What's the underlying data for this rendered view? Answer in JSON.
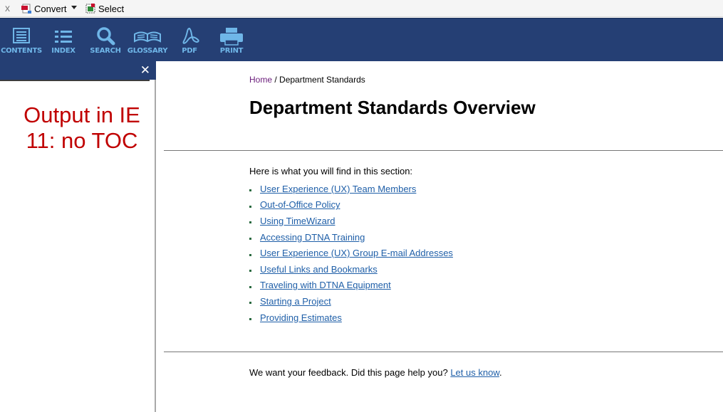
{
  "ie_toolbar": {
    "close_glyph": "x",
    "convert_label": "Convert",
    "select_label": "Select",
    "convert_icon": "pdf-convert-icon",
    "select_icon": "select-icon"
  },
  "help_toolbar": {
    "background": "#253f74",
    "icon_color": "#6fb6e8",
    "tools": [
      {
        "label": "CONTENTS",
        "icon": "contents-icon"
      },
      {
        "label": "INDEX",
        "icon": "index-icon"
      },
      {
        "label": "SEARCH",
        "icon": "search-icon"
      },
      {
        "label": "GLOSSARY",
        "icon": "glossary-icon"
      },
      {
        "label": "PDF",
        "icon": "pdf-icon"
      },
      {
        "label": "PRINT",
        "icon": "print-icon"
      }
    ]
  },
  "nav_pane": {
    "close_glyph": "✕",
    "annotation": "Output in IE 11: no TOC",
    "annotation_color": "#c00000"
  },
  "main": {
    "breadcrumb_home": "Home",
    "breadcrumb_sep": " / ",
    "breadcrumb_current": "Department Standards",
    "title": "Department Standards Overview",
    "intro": "Here is what you will find in this section:",
    "links": [
      "User Experience (UX) Team Members",
      "Out-of-Office Policy",
      "Using TimeWizard",
      "Accessing DTNA Training",
      "User Experience (UX) Group E-mail Addresses",
      "Useful Links and Bookmarks",
      "Traveling with DTNA Equipment",
      "Starting a Project",
      "Providing Estimates"
    ],
    "feedback_text": "We want your feedback. Did this page help you? ",
    "feedback_link": "Let us know",
    "feedback_end": "."
  }
}
